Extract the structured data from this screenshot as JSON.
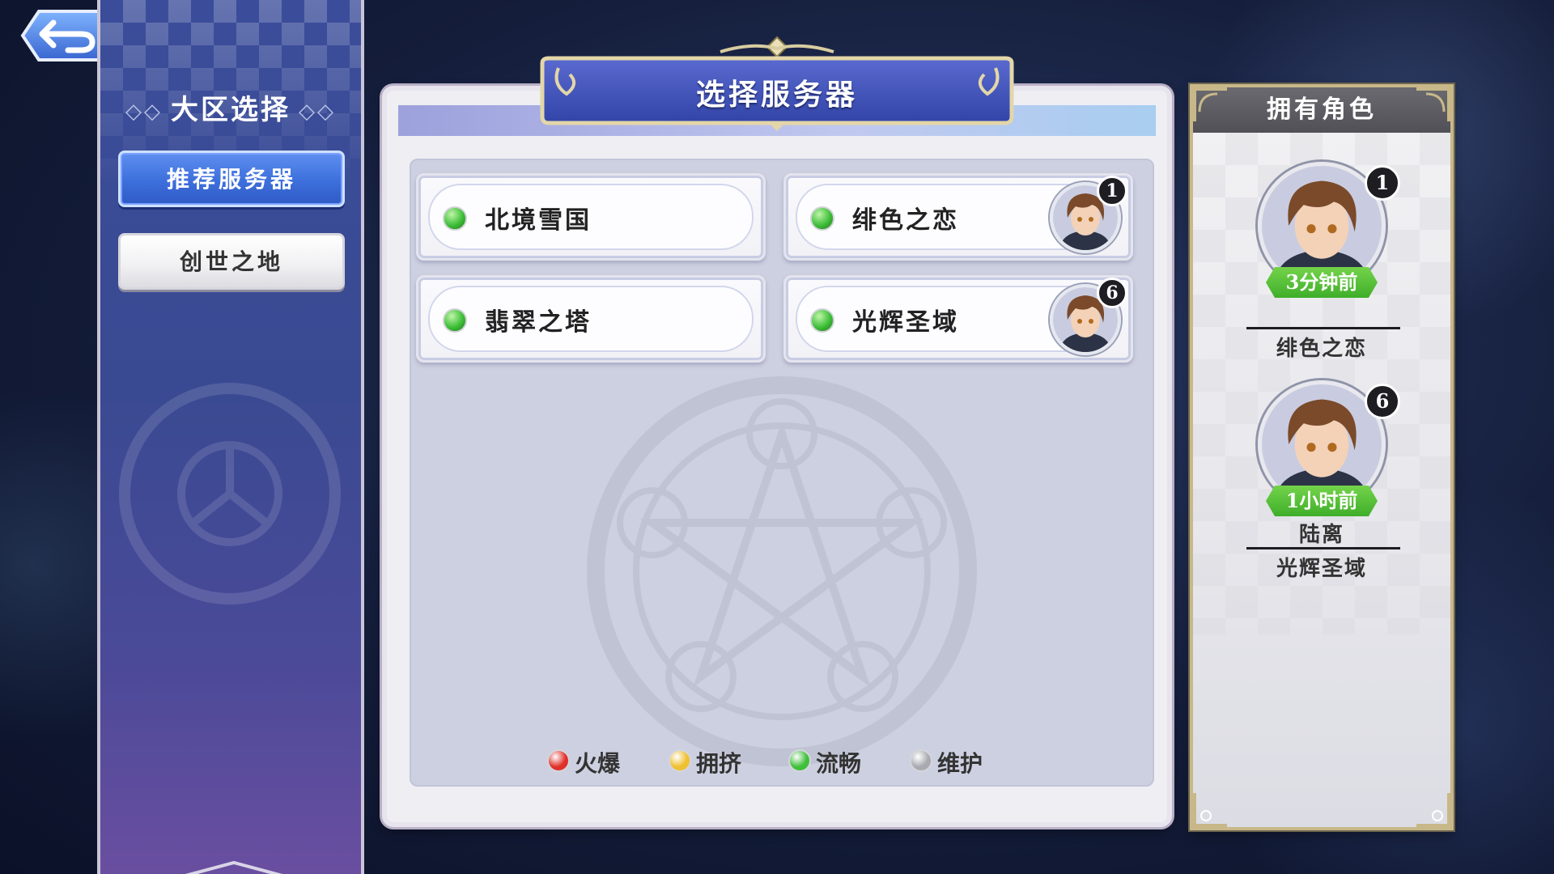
{
  "sidebar": {
    "title": "大区选择",
    "regions": [
      {
        "label": "推荐服务器",
        "active": true
      },
      {
        "label": "创世之地",
        "active": false
      }
    ]
  },
  "main": {
    "title": "选择服务器",
    "servers": [
      {
        "name": "北境雪国",
        "status": "流畅",
        "status_color": "#3fbf3a",
        "character_count": null
      },
      {
        "name": "绯色之恋",
        "status": "流畅",
        "status_color": "#3fbf3a",
        "character_count": "1"
      },
      {
        "name": "翡翠之塔",
        "status": "流畅",
        "status_color": "#3fbf3a",
        "character_count": null
      },
      {
        "name": "光辉圣域",
        "status": "流畅",
        "status_color": "#3fbf3a",
        "character_count": "6"
      }
    ],
    "legend": [
      {
        "label": "火爆",
        "color": "#e0302a"
      },
      {
        "label": "拥挤",
        "color": "#f0c030"
      },
      {
        "label": "流畅",
        "color": "#3fbf3a"
      },
      {
        "label": "维护",
        "color": "#a8aab0"
      }
    ]
  },
  "owned": {
    "title": "拥有角色",
    "characters": [
      {
        "level": "1",
        "last_login": "3分钟前",
        "name": "",
        "server": "绯色之恋"
      },
      {
        "level": "6",
        "last_login": "1小时前",
        "name": "陆离",
        "server": "光辉圣域"
      }
    ]
  },
  "colors": {
    "accent_blue": "#3d6fdc",
    "status_green": "#3fbf3a",
    "frame_gold": "#c8b889"
  },
  "icons": {
    "back": "back-arrow-icon",
    "avatar": "character-portrait-icon"
  }
}
